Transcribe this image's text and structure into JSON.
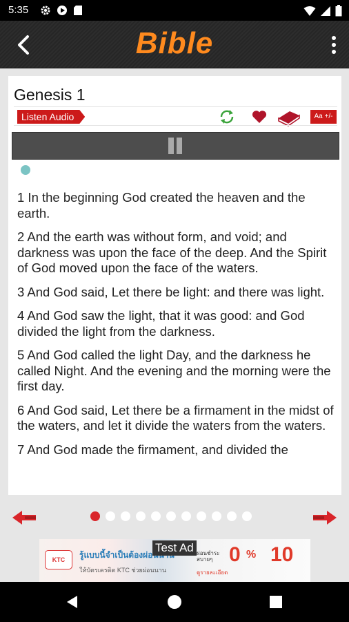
{
  "status_bar": {
    "time": "5:35",
    "icons": [
      "gear-icon",
      "play-icon",
      "sd-card-icon",
      "wifi-icon",
      "signal-icon",
      "battery-icon"
    ]
  },
  "header": {
    "title": "Bible",
    "title_color": "#ff8a1e"
  },
  "chapter": {
    "title": "Genesis 1",
    "listen_label": "Listen Audio",
    "font_size_label": "Aa +/-",
    "accent": "#cc1a1a",
    "repeat_color": "#3aa33a"
  },
  "verses": [
    "1 In the beginning God created the heaven and the earth.",
    "2 And the earth was without form, and void; and darkness was upon the face of the deep. And the Spirit of God moved upon the face of the waters.",
    "3 And God said, Let there be light: and there was light.",
    "4 And God saw the light, that it was good: and God divided the light from the darkness.",
    "5 And God called the light Day, and the darkness he called Night. And the evening and the morning were the first day.",
    "6 And God said, Let there be a firmament in the midst of the waters, and let it divide the waters from the waters.",
    "7 And God made the firmament, and divided the"
  ],
  "pagination": {
    "total_pages": 11,
    "current_page": 1,
    "active_color": "#d9252a"
  },
  "ad": {
    "label": "Test Ad",
    "brand": "KTC",
    "headline": "รู้แบบนี้จำเป็นต้องผ่อนนาน",
    "subline": "ให้บัตรเครดิต KTC ช่วยผ่อนนาน",
    "rate": "0",
    "rate_unit": "%",
    "months": "10",
    "small_text": "ผ่อนชำระสบายๆ",
    "small_text2": "ดูรายละเอียด"
  },
  "nav_bar": {
    "buttons": [
      "back-icon",
      "home-icon",
      "recents-icon"
    ]
  }
}
